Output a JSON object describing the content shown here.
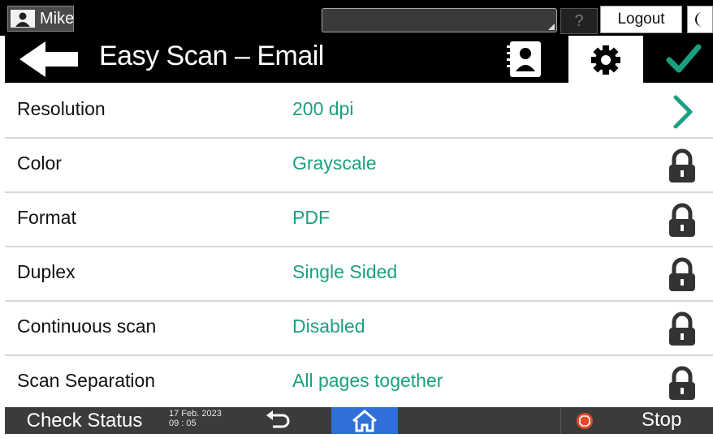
{
  "topbar": {
    "user_name": "Mike",
    "help_label": "?",
    "logout_label": "Logout"
  },
  "header": {
    "title": "Easy Scan – Email"
  },
  "settings": [
    {
      "label": "Resolution",
      "value": "200 dpi",
      "action": "chevron-right-icon"
    },
    {
      "label": "Color",
      "value": "Grayscale",
      "action": "lock-icon"
    },
    {
      "label": "Format",
      "value": "PDF",
      "action": "lock-icon"
    },
    {
      "label": "Duplex",
      "value": "Single Sided",
      "action": "lock-icon"
    },
    {
      "label": "Continuous scan",
      "value": "Disabled",
      "action": "lock-icon"
    },
    {
      "label": "Scan Separation",
      "value": "All pages together",
      "action": "lock-icon"
    }
  ],
  "bottombar": {
    "check_status": "Check Status",
    "date": "17 Feb. 2023",
    "time": "09 : 05",
    "stop_label": "Stop"
  },
  "colors": {
    "accent": "#1aa07f",
    "home": "#2f6fd8",
    "stop": "#e8472a"
  }
}
